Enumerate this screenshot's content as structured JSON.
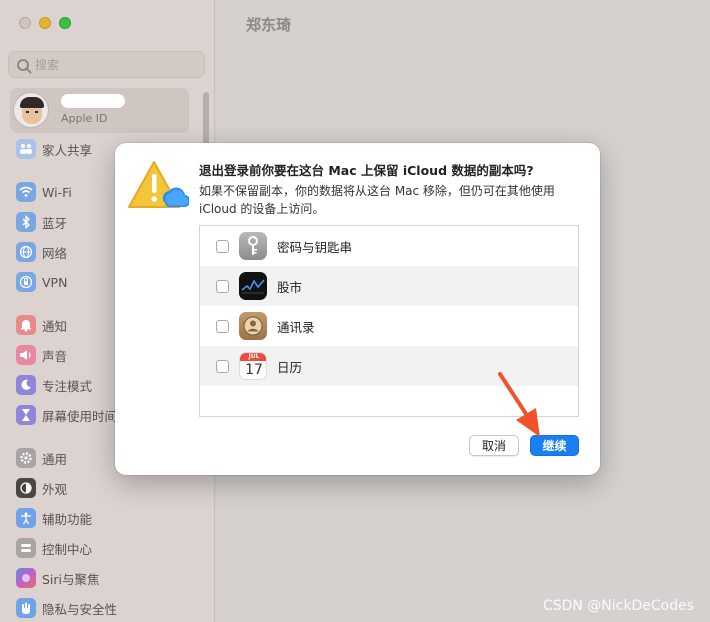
{
  "window": {
    "title": "郑东琦"
  },
  "sidebar": {
    "search_placeholder": "搜索",
    "account": {
      "subtitle": "Apple ID"
    },
    "items": [
      {
        "label": "家人共享",
        "icon": "family-icon",
        "color": "#8db3e8"
      },
      {
        "label": "Wi-Fi",
        "icon": "wifi-icon",
        "color": "#4f8fe0"
      },
      {
        "label": "蓝牙",
        "icon": "bluetooth-icon",
        "color": "#4f8fe0"
      },
      {
        "label": "网络",
        "icon": "globe-icon",
        "color": "#4f8fe0"
      },
      {
        "label": "VPN",
        "icon": "vpn-icon",
        "color": "#4f8fe0"
      },
      {
        "label": "通知",
        "icon": "bell-icon",
        "color": "#e06060"
      },
      {
        "label": "声音",
        "icon": "speaker-icon",
        "color": "#e06078"
      },
      {
        "label": "专注模式",
        "icon": "moon-icon",
        "color": "#6a5fd0"
      },
      {
        "label": "屏幕使用时间",
        "icon": "hourglass-icon",
        "color": "#6a5fd0"
      },
      {
        "label": "通用",
        "icon": "gear-icon",
        "color": "#8e8e8e"
      },
      {
        "label": "外观",
        "icon": "appearance-icon",
        "color": "#2b2b2b"
      },
      {
        "label": "辅助功能",
        "icon": "accessibility-icon",
        "color": "#3a84e0"
      },
      {
        "label": "控制中心",
        "icon": "control-center-icon",
        "color": "#8e8e8e"
      },
      {
        "label": "Siri与聚焦",
        "icon": "siri-icon",
        "color": "#b060d0"
      },
      {
        "label": "隐私与安全性",
        "icon": "hand-icon",
        "color": "#3a84e0"
      }
    ]
  },
  "dialog": {
    "title": "退出登录前你要在这台 Mac 上保留 iCloud 数据的副本吗?",
    "message": "如果不保留副本，你的数据将从这台 Mac 移除，但仍可在其他使用 iCloud 的设备上访问。",
    "items": [
      {
        "label": "密码与钥匙串",
        "icon": "keychain-icon",
        "checked": false
      },
      {
        "label": "股市",
        "icon": "stocks-icon",
        "checked": false
      },
      {
        "label": "通讯录",
        "icon": "contacts-icon",
        "checked": false
      },
      {
        "label": "日历",
        "icon": "calendar-icon",
        "checked": false,
        "calendar_month": "JUL",
        "calendar_day": "17"
      }
    ],
    "cancel_label": "取消",
    "continue_label": "继续"
  },
  "watermark": "CSDN @NickDeCodes",
  "colors": {
    "accent": "#1a7ff0",
    "arrow": "#f0532a"
  }
}
